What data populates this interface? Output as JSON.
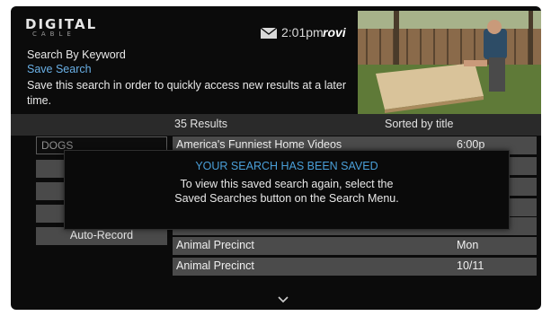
{
  "header": {
    "logo_main": "DIGITAL",
    "logo_sub": "CABLE",
    "time": "2:01pm",
    "brand": "rovi",
    "mail_icon": "mail-icon"
  },
  "info": {
    "heading": "Search By Keyword",
    "action": "Save Search",
    "description": "Save this search in order to quickly access new results at a later time."
  },
  "results_bar": {
    "count": "35 Results",
    "sort": "Sorted by title"
  },
  "sidebar": {
    "keyword": "DOGS",
    "buttons": [
      {
        "label": ""
      },
      {
        "label": ""
      },
      {
        "label": ""
      },
      {
        "label": "Auto-Record"
      }
    ]
  },
  "results": [
    {
      "title": "America's Funniest Home Videos",
      "time": "6:00p"
    },
    {
      "title": "",
      "time": ""
    },
    {
      "title": "",
      "time": ""
    },
    {
      "title": "",
      "time": ""
    },
    {
      "title": "Animal Precinct",
      "time": "Mon"
    },
    {
      "title": "Animal Precinct",
      "time": "10/11"
    }
  ],
  "modal": {
    "title": "YOUR SEARCH HAS BEEN SAVED",
    "line1": "To view this saved search again, select the",
    "line2": "Saved Searches button on the Search Menu."
  },
  "colors": {
    "accent": "#4a9fd8",
    "link": "#6ab0e6",
    "background": "#0b0b0b",
    "row": "#4b4b4b"
  },
  "scroll_icon": "chevron-down-icon"
}
